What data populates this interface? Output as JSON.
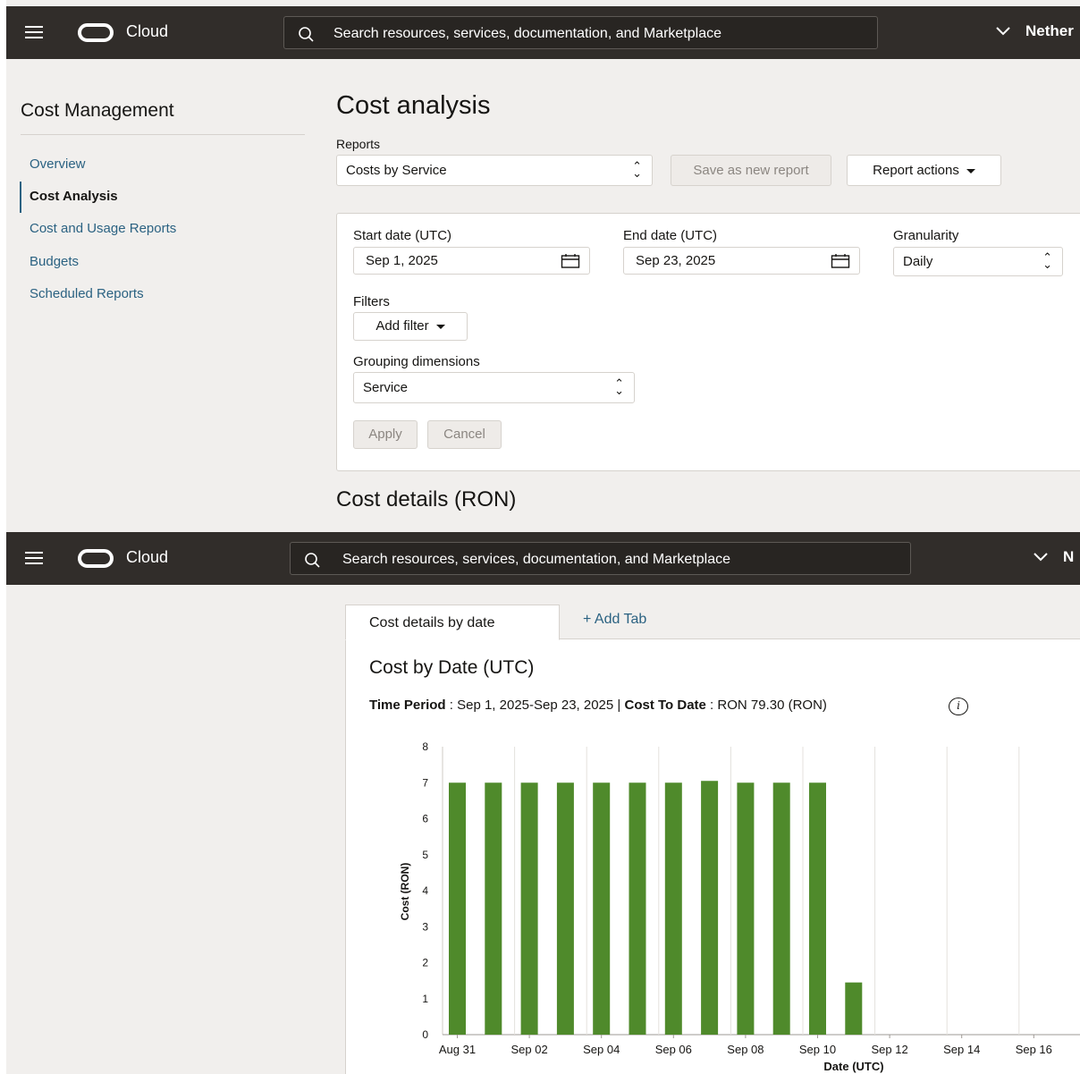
{
  "topbar": {
    "brand": "Cloud",
    "search_placeholder": "Search resources, services, documentation, and Marketplace",
    "region_top": "Nether",
    "region_bottom": "N"
  },
  "sidebar": {
    "title": "Cost Management",
    "items": [
      {
        "label": "Overview"
      },
      {
        "label": "Cost Analysis"
      },
      {
        "label": "Cost and Usage Reports"
      },
      {
        "label": "Budgets"
      },
      {
        "label": "Scheduled Reports"
      }
    ]
  },
  "main": {
    "title": "Cost analysis",
    "reports_label": "Reports",
    "report_selected": "Costs by Service",
    "save_report_label": "Save as new report",
    "report_actions_label": "Report actions",
    "start_date_label": "Start date (UTC)",
    "start_date": "Sep 1, 2025",
    "end_date_label": "End date (UTC)",
    "end_date": "Sep 23, 2025",
    "granularity_label": "Granularity",
    "granularity": "Daily",
    "filters_label": "Filters",
    "add_filter_label": "Add filter",
    "grouping_label": "Grouping dimensions",
    "grouping": "Service",
    "apply_label": "Apply",
    "cancel_label": "Cancel",
    "cost_details_title": "Cost details (RON)"
  },
  "details": {
    "tab_label": "Cost details by date",
    "add_tab_label": "+ Add Tab",
    "chart_title": "Cost by Date (UTC)",
    "time_period_label": "Time Period",
    "time_period_value": " : Sep 1, 2025-Sep 23, 2025 | ",
    "cost_to_date_label": "Cost To Date",
    "cost_to_date_value": " : RON 79.30 (RON)",
    "info_glyph": "i"
  },
  "colors": {
    "bar": "#4f8a2b",
    "topbar": "#312d2a",
    "link": "#2b6282"
  },
  "chart_data": {
    "type": "bar",
    "categories": [
      "Aug 31",
      "Sep 01",
      "Sep 02",
      "Sep 03",
      "Sep 04",
      "Sep 05",
      "Sep 06",
      "Sep 07",
      "Sep 08",
      "Sep 09",
      "Sep 10",
      "Sep 11",
      "Sep 12",
      "Sep 13",
      "Sep 14",
      "Sep 15",
      "Sep 16",
      "Sep 17"
    ],
    "values": [
      7.0,
      7.0,
      7.0,
      7.0,
      7.0,
      7.0,
      7.0,
      7.05,
      7.0,
      7.0,
      7.0,
      1.45,
      0,
      0,
      0,
      0,
      0,
      0
    ],
    "tick_labels": [
      "Aug 31",
      "Sep 02",
      "Sep 04",
      "Sep 06",
      "Sep 08",
      "Sep 10",
      "Sep 12",
      "Sep 14",
      "Sep 16"
    ],
    "y_ticks": [
      0,
      1,
      2,
      3,
      4,
      5,
      6,
      7,
      8
    ],
    "ylabel": "Cost (RON)",
    "xlabel": "Date (UTC)",
    "ylim": [
      0,
      8
    ],
    "grid": "vertical"
  }
}
